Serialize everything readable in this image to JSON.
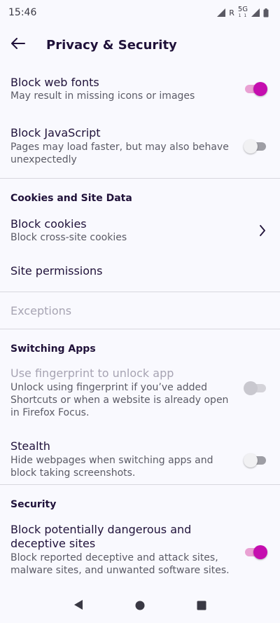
{
  "status_bar": {
    "time": "15:46",
    "roaming": "R",
    "network": "5G",
    "network_sub": "1 1"
  },
  "app_bar": {
    "title": "Privacy & Security"
  },
  "block_web_fonts": {
    "title": "Block web fonts",
    "subtitle": "May result in missing icons or images",
    "enabled": true
  },
  "block_javascript": {
    "title": "Block JavaScript",
    "subtitle_line1": "Pages may load faster, but may also behave",
    "subtitle_line2": "unexpectedly",
    "enabled": false
  },
  "cookies_section": {
    "header": "Cookies and Site Data"
  },
  "block_cookies": {
    "title": "Block cookies",
    "subtitle": "Block cross-site cookies"
  },
  "site_permissions": {
    "title": "Site permissions"
  },
  "exceptions": {
    "title": "Exceptions"
  },
  "switching_section": {
    "header": "Switching Apps"
  },
  "fingerprint": {
    "title": "Use fingerprint to unlock app",
    "subtitle_line1": "Unlock using fingerprint if you’ve added",
    "subtitle_line2": "Shortcuts or when a website is already open",
    "subtitle_line3": "in Firefox Focus.",
    "enabled": false
  },
  "stealth": {
    "title": "Stealth",
    "subtitle_line1": "Hide webpages when switching apps and",
    "subtitle_line2": "block taking screenshots.",
    "enabled": false
  },
  "security_section": {
    "header": "Security"
  },
  "safe_browsing": {
    "title_line1": "Block potentially dangerous and",
    "title_line2": "deceptive sites",
    "subtitle_line1": "Block reported deceptive and attack sites,",
    "subtitle_line2": "malware sites, and unwanted software sites.",
    "enabled": true
  },
  "colors": {
    "accent": "#c50eaf",
    "accent_track": "#e9a1d3",
    "background": "#f9f9fe",
    "text": "#20123a"
  },
  "nav_bar": {
    "back_icon": "triangle-back-icon",
    "home_icon": "circle-home-icon",
    "recents_icon": "square-recents-icon"
  }
}
